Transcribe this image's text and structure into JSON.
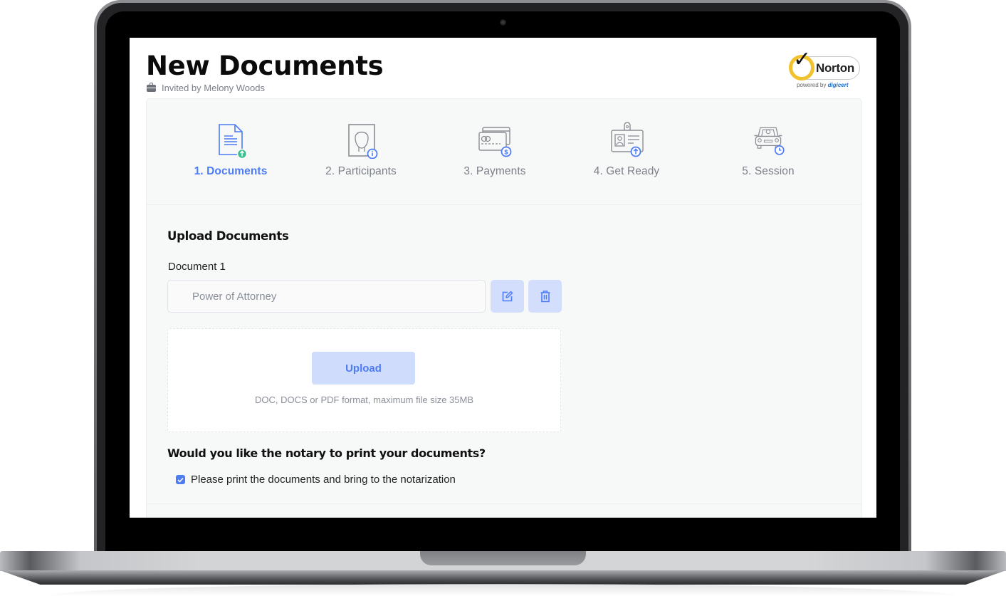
{
  "page": {
    "title": "New Documents",
    "invited_by": "Invited by Melony Woods"
  },
  "badge": {
    "brand": "Norton",
    "powered_by": "powered by",
    "partner": "digicert"
  },
  "steps": [
    {
      "label": "1. Documents",
      "icon": "document-upload-icon",
      "active": true
    },
    {
      "label": "2. Participants",
      "icon": "person-info-icon",
      "active": false
    },
    {
      "label": "3. Payments",
      "icon": "credit-card-dollar-icon",
      "active": false
    },
    {
      "label": "4. Get Ready",
      "icon": "id-badge-upload-icon",
      "active": false
    },
    {
      "label": "5. Session",
      "icon": "car-clock-icon",
      "active": false
    }
  ],
  "upload": {
    "heading": "Upload Documents",
    "document_label": "Document 1",
    "document_value": "Power of Attorney",
    "edit_icon": "edit-icon",
    "delete_icon": "trash-icon",
    "upload_button": "Upload",
    "hint": "DOC, DOCS or PDF format, maximum file size 35MB"
  },
  "print": {
    "question": "Would you like the notary to print your documents?",
    "checkbox_label": "Please print the documents and bring to the notarization",
    "checked": true
  },
  "colors": {
    "accent": "#4d7cf4",
    "accent_light": "#d0dcfb",
    "success": "#3dbf8f",
    "muted_text": "#7c8089",
    "norton_yellow": "#f2c12e"
  }
}
